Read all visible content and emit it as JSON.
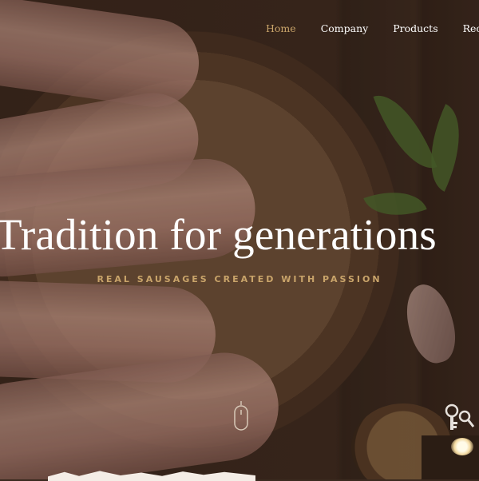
{
  "nav": {
    "items": [
      {
        "label": "Home",
        "active": true
      },
      {
        "label": "Company",
        "active": false
      },
      {
        "label": "Products",
        "active": false
      },
      {
        "label": "Recipes",
        "active": false
      }
    ]
  },
  "hero": {
    "title": "Tradition for generations",
    "subtitle": "REAL SAUSAGES CREATED WITH PASSION",
    "scroll_icon": "mouse-icon",
    "accessibility_icon": "key-icon"
  },
  "colors": {
    "accent": "#c9a46a",
    "text": "#ffffff"
  }
}
